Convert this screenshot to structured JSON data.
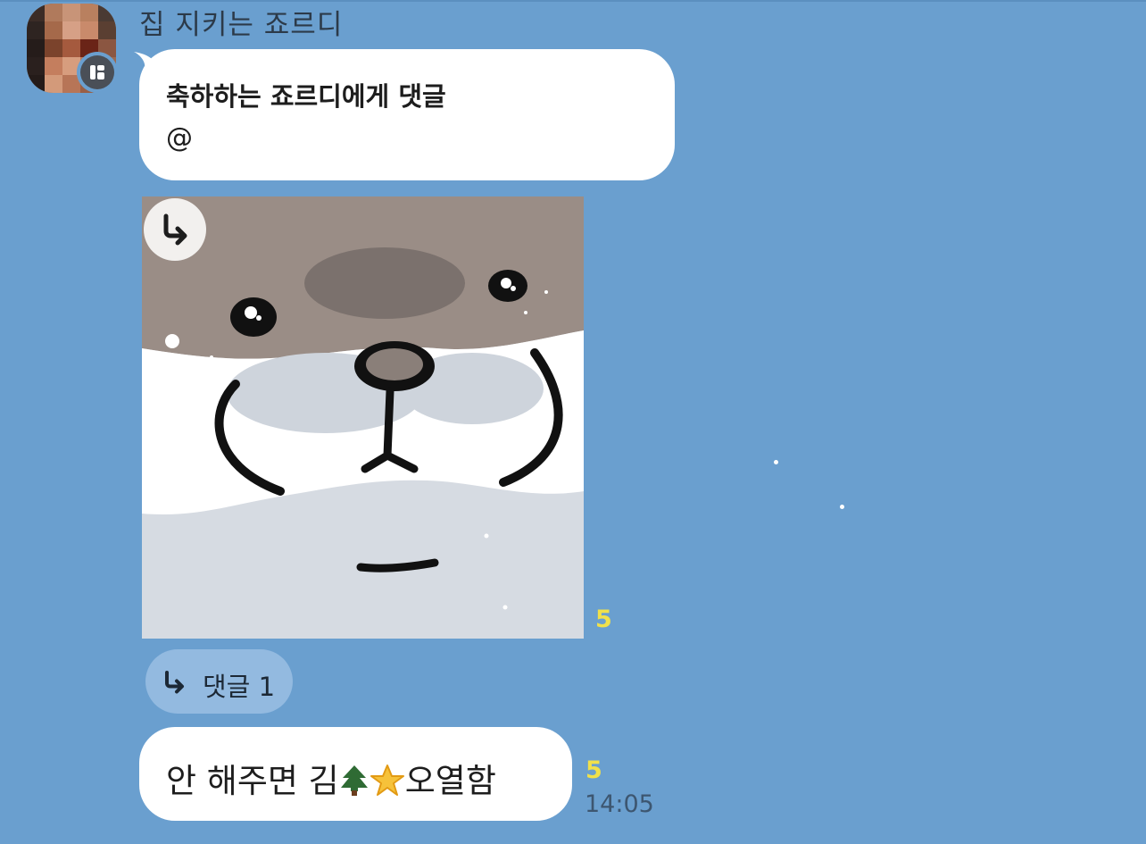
{
  "chat": {
    "sender_name": "집 지키는 죠르디",
    "message1": {
      "title": "축하하는 죠르디에게 댓글",
      "mention": "@"
    },
    "sticker_unread": "5",
    "reply_thread": {
      "label": "댓글 1"
    },
    "message2": {
      "text_before": "안 해주면 김",
      "text_after": "오열함",
      "emoji_1": "christmas-tree",
      "emoji_2": "star",
      "unread": "5",
      "time": "14:05"
    }
  },
  "colors": {
    "background": "#6a9fcf",
    "bubble": "#ffffff",
    "unread": "#f1e14a",
    "reply_pill": "#93bae0"
  }
}
